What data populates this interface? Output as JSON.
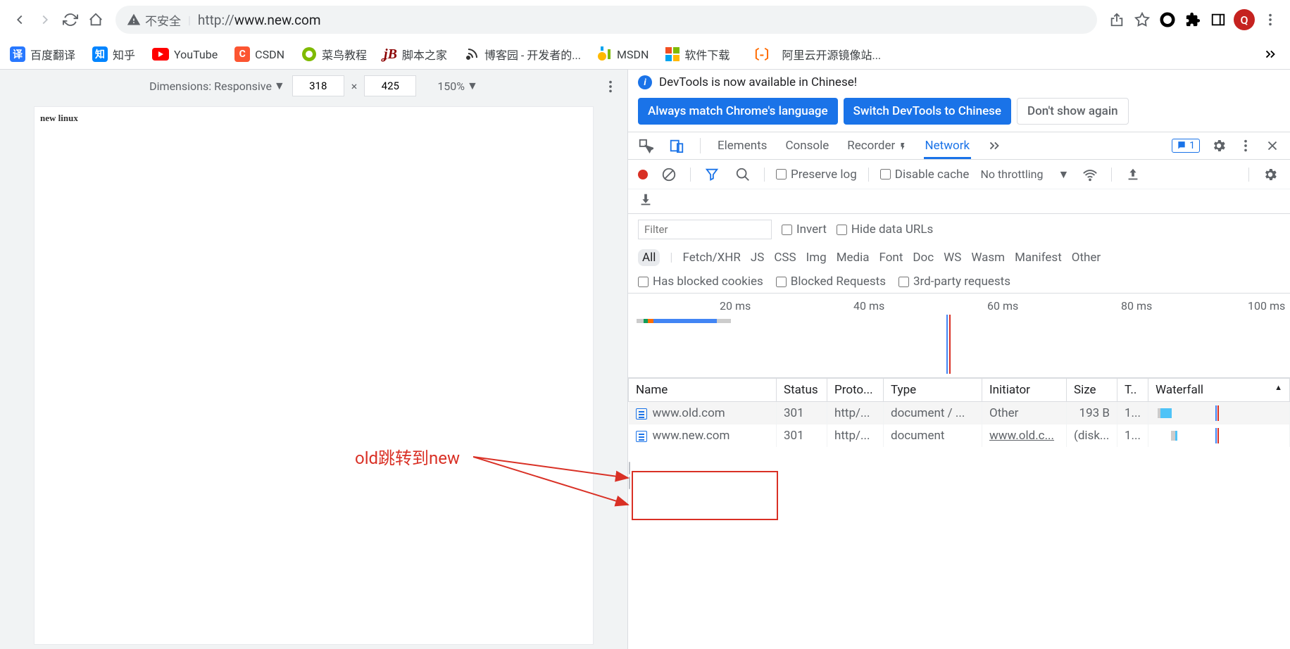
{
  "browser": {
    "insecure": "不安全",
    "url_prefix": "http://",
    "url_host": "www.new.com",
    "avatar": "Q"
  },
  "bookmarks": [
    {
      "label": "百度翻译",
      "bg": "#2878ff",
      "txt": "译"
    },
    {
      "label": "知乎",
      "bg": "#0084ff",
      "txt": "知"
    },
    {
      "label": "YouTube",
      "bg": "transparent",
      "txt": ""
    },
    {
      "label": "CSDN",
      "bg": "#fc5531",
      "txt": "C"
    },
    {
      "label": "菜鸟教程",
      "bg": "transparent",
      "txt": ""
    },
    {
      "label": "脚本之家",
      "bg": "transparent",
      "txt": ""
    },
    {
      "label": "博客园 - 开发者的...",
      "bg": "transparent",
      "txt": ""
    },
    {
      "label": "MSDN",
      "bg": "transparent",
      "txt": ""
    },
    {
      "label": "软件下载",
      "bg": "transparent",
      "txt": ""
    },
    {
      "label": "阿里云开源镜像站...",
      "bg": "transparent",
      "txt": ""
    }
  ],
  "dims": {
    "label": "Dimensions: Responsive",
    "w": "318",
    "x": "×",
    "h": "425",
    "zoom": "150%"
  },
  "page_text": "new linux",
  "info": {
    "msg": "DevTools is now available in Chinese!",
    "b1": "Always match Chrome's language",
    "b2": "Switch DevTools to Chinese",
    "b3": "Don't show again"
  },
  "tabs": {
    "elements": "Elements",
    "console": "Console",
    "recorder": "Recorder",
    "network": "Network",
    "badge": "1"
  },
  "ctrl": {
    "preserve": "Preserve log",
    "disable": "Disable cache",
    "throttle": "No throttling"
  },
  "filter": {
    "ph": "Filter",
    "invert": "Invert",
    "hide": "Hide data URLs"
  },
  "types": {
    "all": "All",
    "fetch": "Fetch/XHR",
    "js": "JS",
    "css": "CSS",
    "img": "Img",
    "media": "Media",
    "font": "Font",
    "doc": "Doc",
    "ws": "WS",
    "wasm": "Wasm",
    "manifest": "Manifest",
    "other": "Other"
  },
  "checks": {
    "blocked": "Has blocked cookies",
    "req": "Blocked Requests",
    "third": "3rd-party requests"
  },
  "timeline": {
    "t20": "20 ms",
    "t40": "40 ms",
    "t60": "60 ms",
    "t80": "80 ms",
    "t100": "100 ms"
  },
  "headers": {
    "name": "Name",
    "status": "Status",
    "proto": "Proto...",
    "type": "Type",
    "init": "Initiator",
    "size": "Size",
    "time": "T..",
    "wf": "Waterfall"
  },
  "rows": [
    {
      "name": "www.old.com",
      "status": "301",
      "proto": "http/...",
      "type": "document / ...",
      "init": "Other",
      "size": "193 B",
      "time": "1..."
    },
    {
      "name": "www.new.com",
      "status": "301",
      "proto": "http/...",
      "type": "document",
      "init": "www.old.c...",
      "size": "(disk...",
      "time": "1..."
    }
  ],
  "annotation": "old跳转到new"
}
